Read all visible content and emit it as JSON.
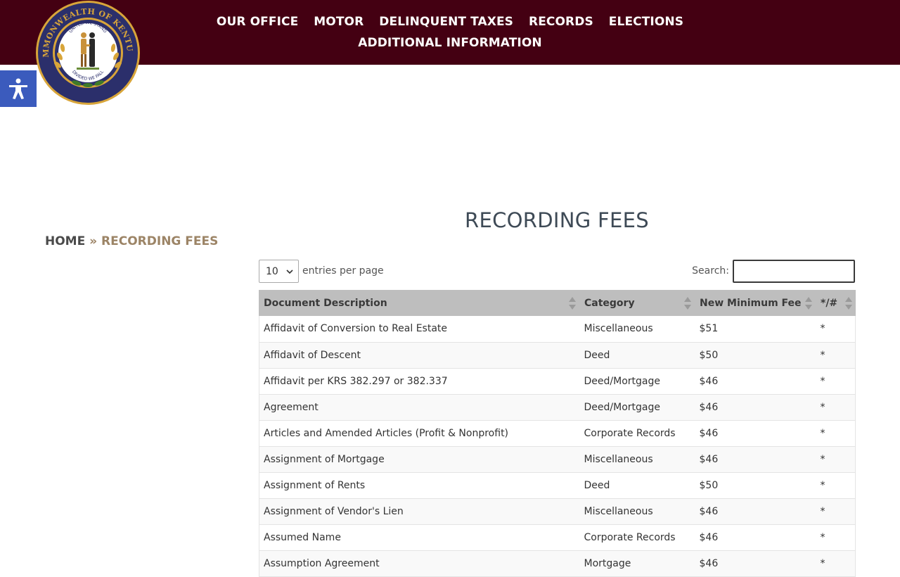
{
  "header": {
    "nav_row1": [
      {
        "label": "OUR OFFICE"
      },
      {
        "label": "MOTOR"
      },
      {
        "label": "DELINQUENT TAXES"
      },
      {
        "label": "RECORDS"
      },
      {
        "label": "ELECTIONS"
      }
    ],
    "nav_row2": [
      {
        "label": "ADDITIONAL INFORMATION"
      }
    ],
    "seal": {
      "outer_text": "COMMONWEALTH OF KENTUCKY",
      "inner_top": "UNITED WE STAND",
      "inner_bottom": "DIVIDED WE FALL"
    },
    "colors": {
      "header_bg": "#440012",
      "seal_ring": "#2b2f6b",
      "seal_gold": "#d8a53a",
      "accessibility_bg": "#3b5bbd"
    }
  },
  "accessibility": {
    "icon": "accessibility-person-icon"
  },
  "breadcrumb": {
    "home": "HOME",
    "separator": "»",
    "current": "RECORDING FEES"
  },
  "page": {
    "title": "RECORDING FEES"
  },
  "table_controls": {
    "length_value": "10",
    "length_label": "entries per page",
    "search_label": "Search:",
    "search_value": "",
    "search_placeholder": ""
  },
  "table": {
    "columns": [
      {
        "label": "Document Description"
      },
      {
        "label": "Category"
      },
      {
        "label": "New Minimum Fee"
      },
      {
        "label": "*/#"
      }
    ],
    "rows": [
      {
        "description": "Affidavit of Conversion to Real Estate",
        "category": "Miscellaneous",
        "fee": "$51",
        "mark": "*"
      },
      {
        "description": "Affidavit of Descent",
        "category": "Deed",
        "fee": "$50",
        "mark": "*"
      },
      {
        "description": "Affidavit per KRS 382.297 or 382.337",
        "category": "Deed/Mortgage",
        "fee": "$46",
        "mark": "*"
      },
      {
        "description": "Agreement",
        "category": "Deed/Mortgage",
        "fee": "$46",
        "mark": "*"
      },
      {
        "description": "Articles and Amended Articles (Profit & Nonprofit)",
        "category": "Corporate Records",
        "fee": "$46",
        "mark": "*"
      },
      {
        "description": "Assignment of Mortgage",
        "category": "Miscellaneous",
        "fee": "$46",
        "mark": "*"
      },
      {
        "description": "Assignment of Rents",
        "category": "Deed",
        "fee": "$50",
        "mark": "*"
      },
      {
        "description": "Assignment of Vendor's Lien",
        "category": "Miscellaneous",
        "fee": "$46",
        "mark": "*"
      },
      {
        "description": "Assumed Name",
        "category": "Corporate Records",
        "fee": "$46",
        "mark": "*"
      },
      {
        "description": "Assumption Agreement",
        "category": "Mortgage",
        "fee": "$46",
        "mark": "*"
      }
    ]
  }
}
